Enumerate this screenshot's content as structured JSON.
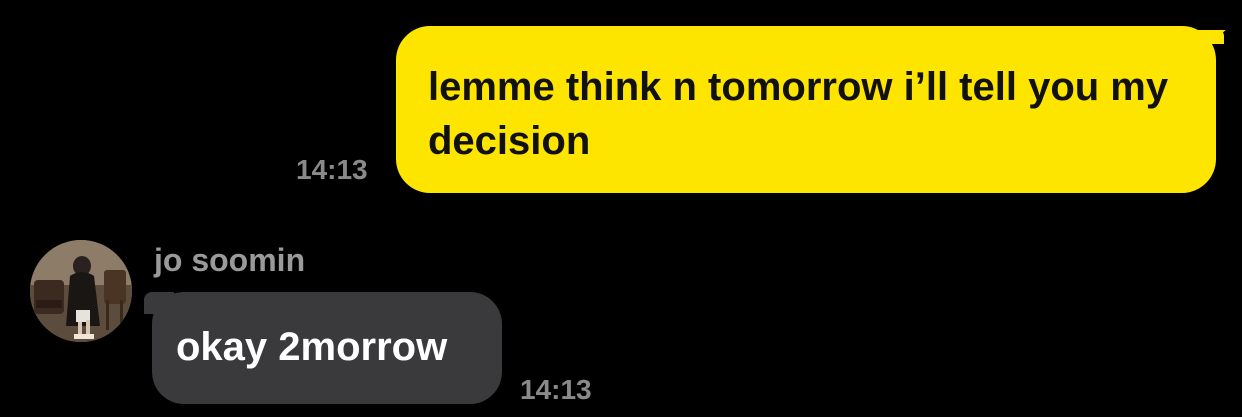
{
  "messages": {
    "outgoing": {
      "text": "lemme think n tomorrow i’ll tell you my decision",
      "time": "14:13",
      "bubble_color": "#FEE500"
    },
    "incoming": {
      "sender": "jo soomin",
      "text": "okay 2morrow",
      "time": "14:13",
      "bubble_color": "#3A3A3C",
      "avatar_icon": "user-photo-avatar"
    }
  },
  "theme": {
    "background": "#000000",
    "timestamp_color": "#8A8A8A",
    "sender_name_color": "#9A9A9A"
  }
}
